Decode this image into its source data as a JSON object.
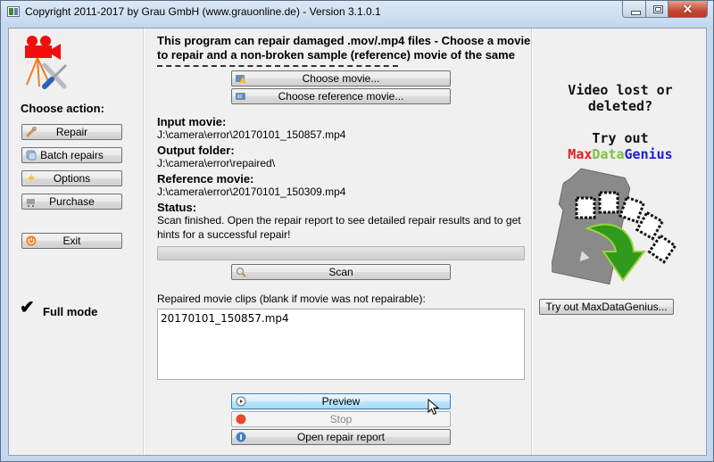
{
  "window": {
    "title": "Copyright 2011-2017 by Grau GmbH (www.grauonline.de) - Version 3.1.0.1",
    "minimize_icon": "minimize-icon",
    "maximize_icon": "maximize-icon",
    "close_icon": "close-icon",
    "close_glyph": "✕"
  },
  "sidebar": {
    "logo_icon": "camera-tools-icon",
    "heading": "Choose action:",
    "items": [
      {
        "label": "Repair",
        "icon": "wrench-icon"
      },
      {
        "label": "Batch repairs",
        "icon": "batch-icon"
      },
      {
        "label": "Options",
        "icon": "lightning-icon"
      },
      {
        "label": "Purchase",
        "icon": "cart-icon"
      }
    ],
    "exit": {
      "label": "Exit",
      "icon": "power-icon"
    },
    "mode": {
      "label": "Full mode",
      "icon": "checkmark-icon",
      "glyph": "✔"
    }
  },
  "main": {
    "intro_line1": "This program can repair damaged .mov/.mp4 files - Choose a movie",
    "intro_line2": "to repair and a non-broken sample (reference) movie of the same",
    "choose_movie": "Choose movie...",
    "choose_reference": "Choose reference movie...",
    "input_label": "Input movie:",
    "input_value": "J:\\camera\\error\\20170101_150857.mp4",
    "output_label": "Output folder:",
    "output_value": "J:\\camera\\error\\repaired\\",
    "reference_label": "Reference movie:",
    "reference_value": "J:\\camera\\error\\20170101_150309.mp4",
    "status_label": "Status:",
    "status_line1": "Scan finished. Open the repair report to see detailed repair results and to get",
    "status_line2": "hints for a successful repair!",
    "progress_percent": 0,
    "scan": "Scan",
    "clips_label": "Repaired movie clips (blank if movie was not repairable):",
    "clips": [
      "20170101_150857.mp4"
    ],
    "preview": "Preview",
    "stop": "Stop",
    "open_report": "Open repair report"
  },
  "promo": {
    "line1": "Video lost or",
    "line2": "deleted?",
    "line3": "Try out",
    "brand_part1": "Max",
    "brand_part2": "Data",
    "brand_part3": "Genius",
    "brand_colors": [
      "#e02020",
      "#7cc242",
      "#2020d0"
    ],
    "image_icon": "sd-card-recovery-icon",
    "button": "Try out MaxDataGenius..."
  }
}
